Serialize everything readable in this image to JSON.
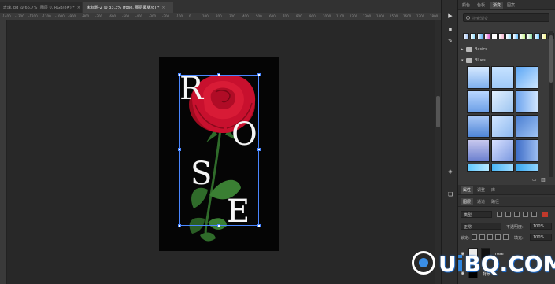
{
  "tabs": [
    {
      "label": "玫瑰.jpg @ 66.7% (图层 0, RGB/8#) *",
      "close": "×",
      "active": false
    },
    {
      "label": "未标题-2 @ 33.3% (rose, 图层蒙版/8) *",
      "close": "×",
      "active": true
    }
  ],
  "ruler": {
    "top_numbers": [
      "-1400",
      "-1300",
      "-1200",
      "-1100",
      "-1000",
      "-900",
      "-800",
      "-700",
      "-600",
      "-500",
      "-400",
      "-300",
      "-200",
      "-100",
      "0",
      "100",
      "200",
      "300",
      "400",
      "500",
      "600",
      "700",
      "800",
      "900",
      "1000",
      "1100",
      "1200",
      "1300",
      "1400",
      "1500",
      "1600",
      "1700",
      "1800"
    ]
  },
  "canvas": {
    "letters": [
      "R",
      "O",
      "S",
      "E"
    ],
    "colors": {
      "background": "#050505",
      "rose_red": "#c8102e",
      "leaf_green": "#2f6b2a",
      "letter": "#f5f5f5"
    }
  },
  "toolstrip": {
    "icons": [
      "play-icon",
      "chat-icon",
      "brush-icon",
      "shapes-icon",
      "layers-icon"
    ]
  },
  "gradients_panel": {
    "tabs": [
      "颜色",
      "色板",
      "渐变",
      "图案"
    ],
    "active_tab": 2,
    "search_placeholder": "搜索渐变",
    "groups": [
      {
        "label": "Basics",
        "expanded": false
      },
      {
        "label": "Blues",
        "expanded": true
      }
    ],
    "recent_colors": [
      "#8fb7f0",
      "#7fd8ff",
      "#5db0f2",
      "#e060d0",
      "#ffffff",
      "#f5b8d0",
      "#a0e4ff",
      "#6ac0ff",
      "#c0f080",
      "#8ee0a0",
      "#70c8ff",
      "#f0f070",
      "#a8c8ff"
    ]
  },
  "layers_panel": {
    "tabs": [
      "图层",
      "通道",
      "路径"
    ],
    "tabs_top": [
      "属性",
      "调整",
      "库"
    ],
    "kind_label": "类型",
    "blend_mode": "正常",
    "opacity_label": "不透明度:",
    "opacity": "100%",
    "lock_label": "锁定:",
    "fill_label": "填充:",
    "fill": "100%",
    "layers": [
      {
        "name": "rose"
      },
      {
        "name": "背景"
      }
    ]
  },
  "watermark": {
    "prefix": "U",
    "highlight": "i",
    "rest": "BQ.COM"
  }
}
